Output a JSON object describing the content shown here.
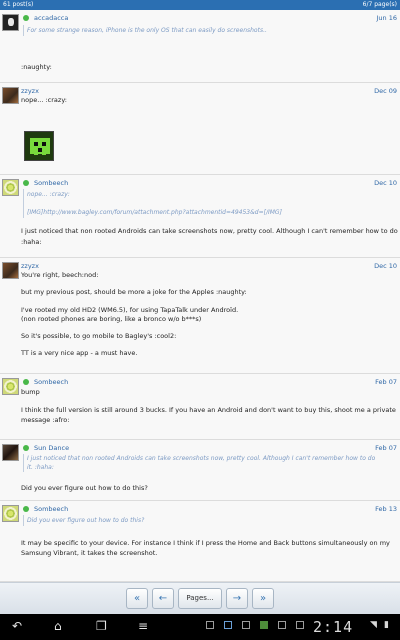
{
  "topbar": {
    "post_count": "61 post(s)",
    "page_indicator": "6/7 page(s)"
  },
  "posts": [
    {
      "user": "accadacca",
      "date": "Jun 16",
      "quote": "For some strange reason, iPhone is the only OS that can easily do screenshots..",
      "lines": [
        ":naughty:"
      ]
    },
    {
      "user": "zzyzx",
      "date": "Dec 09",
      "lines": [
        "nope... :crazy:"
      ]
    },
    {
      "user": "Sombeech",
      "date": "Dec 10",
      "quote_lines": [
        "nope... :crazy:",
        "[IMG]http://www.bagley.com/forum/attachment.php?attachmentid=49453&d=[/IMG]"
      ],
      "lines": [
        "I just noticed that non rooted Androids can take screenshots now, pretty cool. Although I can't remember how to do it.",
        ":haha:"
      ]
    },
    {
      "user": "zzyzx",
      "date": "Dec 10",
      "lines": [
        "You're right, beech:nod:",
        "but my previous post, should be more a joke for the Apples :naughty:",
        "I've rooted my old HD2 (WM6.5), for using TapaTalk under Androïd.",
        "(non rooted phones are boring, like a bronco w/o b***s)",
        "So it's possible, to go mobile to Bagley's :cool2:",
        "TT is a very nice app - a must have."
      ]
    },
    {
      "user": "Sombeech",
      "date": "Feb 07",
      "lines": [
        "bump",
        "I think the full version is still around 3 bucks. If you have an Android and don't want to buy this, shoot me a private",
        "message :afro:"
      ]
    },
    {
      "user": "Sun Dance",
      "date": "Feb 07",
      "quote_lines": [
        "I just noticed that non rooted Androids can take screenshots now, pretty cool. Although I can't remember how to do",
        "it. :haha:"
      ],
      "lines": [
        "Did you ever figure out how to do this?"
      ]
    },
    {
      "user": "Sombeech",
      "date": "Feb 13",
      "quote": "Did you ever figure out how to do this?",
      "lines": [
        "It may be specific to your device. For instance I think if I press the Home and Back buttons simultaneously on my",
        "Samsung Vibrant, it takes the screenshot."
      ]
    }
  ],
  "pager": {
    "first": "«",
    "prev": "←",
    "pages_label": "Pages...",
    "next": "→",
    "last": "»"
  },
  "navbar": {
    "clock": "2:14"
  }
}
